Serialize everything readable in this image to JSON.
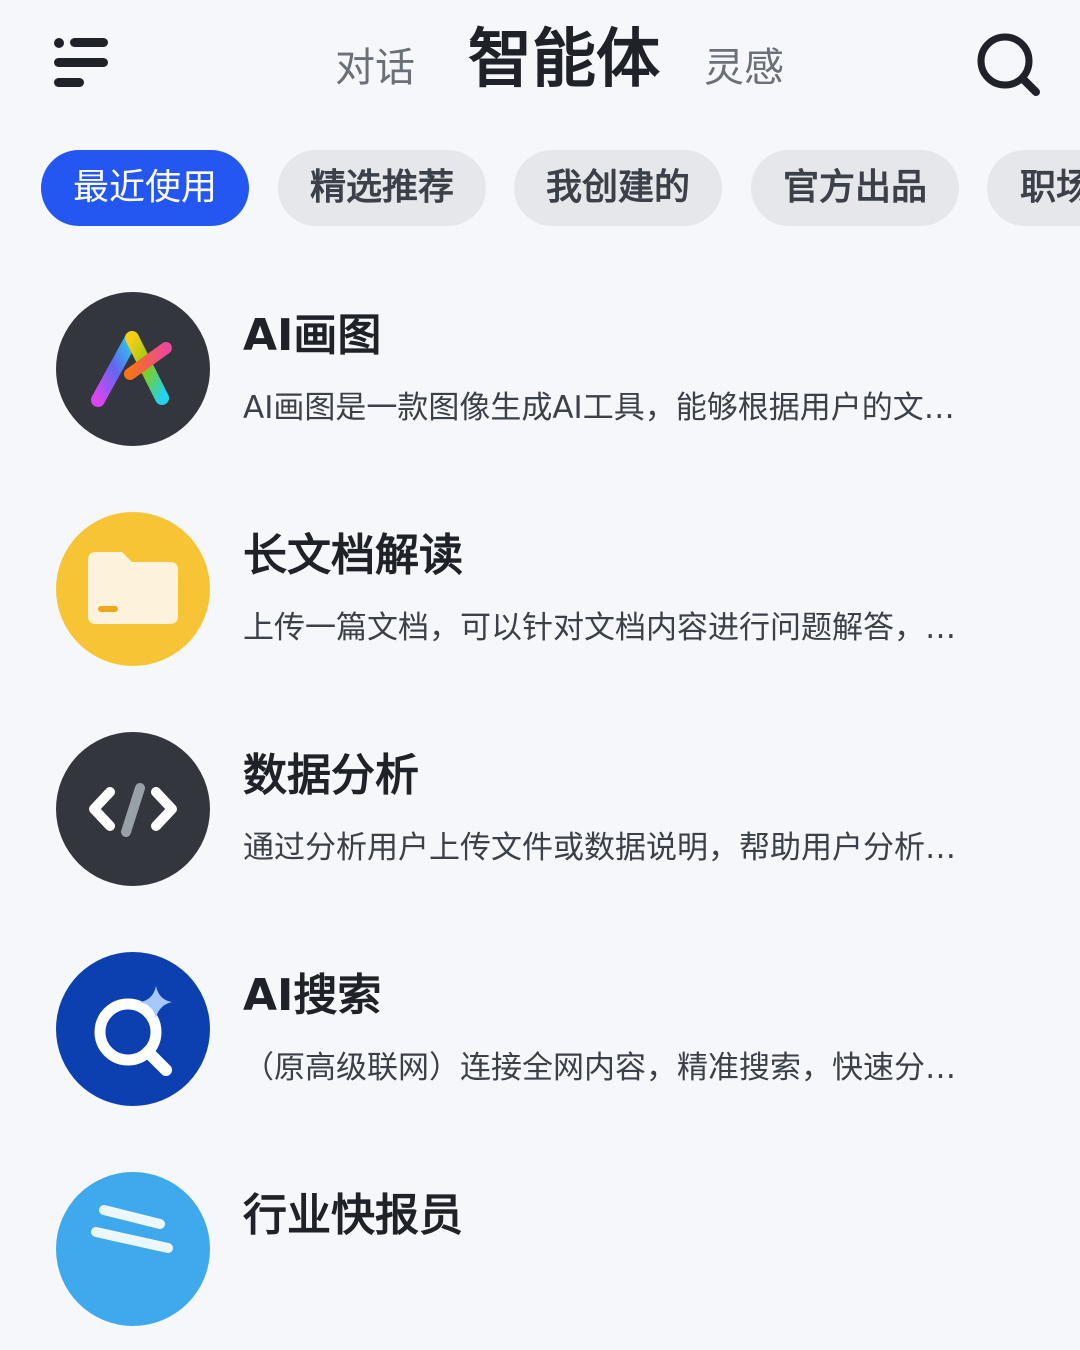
{
  "header": {
    "tabs": [
      {
        "label": "对话"
      },
      {
        "label": "智能体"
      },
      {
        "label": "灵感"
      }
    ],
    "active_tab": "智能体"
  },
  "chips": [
    {
      "label": "最近使用",
      "active": true
    },
    {
      "label": "精选推荐",
      "active": false
    },
    {
      "label": "我创建的",
      "active": false
    },
    {
      "label": "官方出品",
      "active": false
    },
    {
      "label": "职场",
      "active": false
    }
  ],
  "agents": [
    {
      "title": "AI画图",
      "desc": "AI画图是一款图像生成AI工具，能够根据用户的文…",
      "icon": "ai-drawing-icon",
      "color": "#33363d"
    },
    {
      "title": "长文档解读",
      "desc": "上传一篇文档，可以针对文档内容进行问题解答，…",
      "icon": "folder-icon",
      "color": "#f7c436"
    },
    {
      "title": "数据分析",
      "desc": "通过分析用户上传文件或数据说明，帮助用户分析…",
      "icon": "code-icon",
      "color": "#33363d"
    },
    {
      "title": "AI搜索",
      "desc": "（原高级联网）连接全网内容，精准搜索，快速分…",
      "icon": "ai-search-icon",
      "color": "#0c3fb0"
    },
    {
      "title": "行业快报员",
      "desc": "",
      "icon": "stripes-icon",
      "color": "#3ea9ec"
    }
  ],
  "colors": {
    "accent": "#2457f2",
    "background": "#f5f7fa",
    "chip_bg": "#e5e7eb"
  }
}
